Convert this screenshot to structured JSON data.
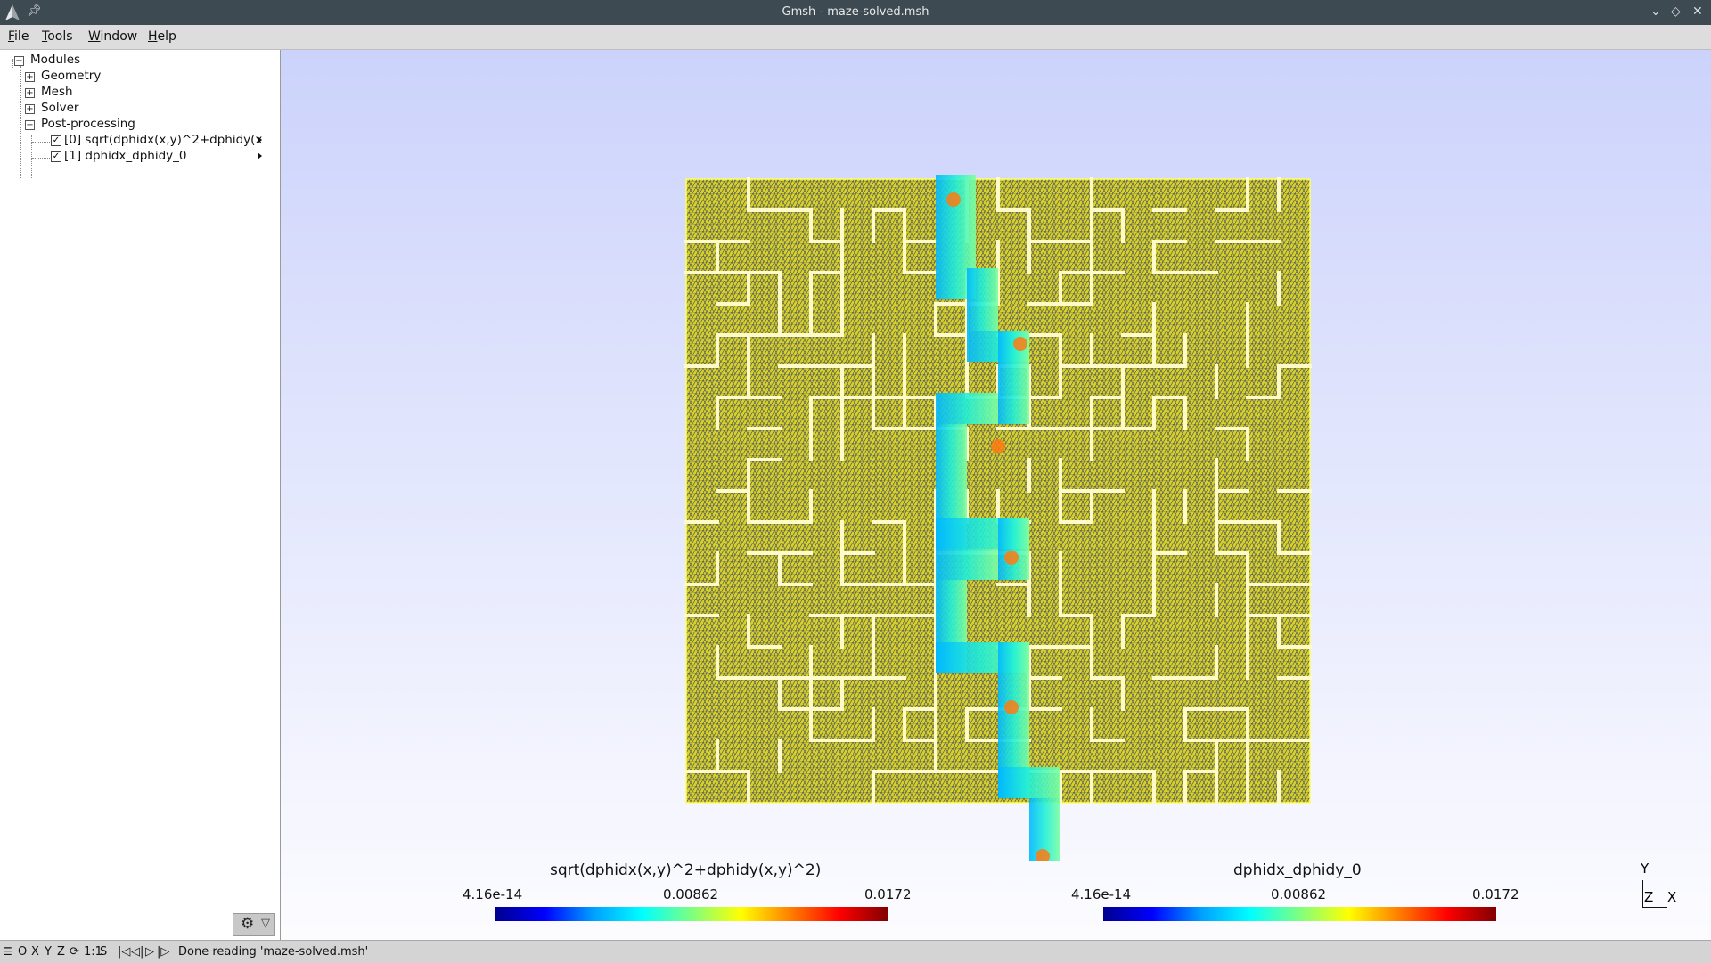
{
  "window": {
    "title": "Gmsh - maze-solved.msh",
    "controls": {
      "minimize": "⌵",
      "maximize": "◇",
      "close": "✕"
    }
  },
  "menubar": {
    "file": {
      "key": "F",
      "rest": "ile"
    },
    "tools": {
      "key": "T",
      "rest": "ools"
    },
    "window": {
      "key": "W",
      "rest": "indow"
    },
    "help": {
      "key": "H",
      "rest": "elp"
    }
  },
  "tree": {
    "root": "Modules",
    "modules": [
      "Geometry",
      "Mesh",
      "Solver",
      "Post-processing"
    ],
    "views": [
      {
        "label": "[0] sqrt(dphidx(x,y)^2+dphidy(x",
        "checked": true
      },
      {
        "label": "[1] dphidx_dphidy_0",
        "checked": true
      }
    ]
  },
  "viewport": {
    "background_top": "#ccd3fb",
    "background_bottom": "#fcfcff",
    "mesh_color": "#c8c21a",
    "wall_color": "#fffbc0",
    "colorbars": [
      {
        "title": "sqrt(dphidx(x,y)^2+dphidy(x,y)^2)",
        "min": "4.16e-14",
        "mid": "0.00862",
        "max": "0.0172"
      },
      {
        "title": "dphidx_dphidy_0",
        "min": "4.16e-14",
        "mid": "0.00862",
        "max": "0.0172"
      }
    ],
    "axes": {
      "y": "Y",
      "z": "Z",
      "x": "X"
    }
  },
  "statusbar": {
    "buttons": [
      "O",
      "X",
      "Y",
      "Z"
    ],
    "scale": "1:1",
    "s_label": "S",
    "message": "Done reading 'maze-solved.msh'"
  }
}
